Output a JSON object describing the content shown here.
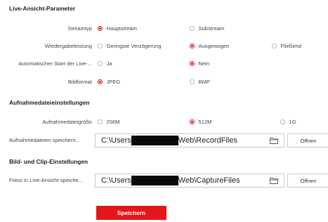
{
  "live_view": {
    "title": "Live-Ansicht-Parameter",
    "stream_type": {
      "label": "Streamtyp",
      "options": [
        {
          "label": "Hauptstream",
          "selected": true
        },
        {
          "label": "Substream",
          "selected": false
        }
      ]
    },
    "playback_delay": {
      "label": "Wiedergabeleistung",
      "options": [
        {
          "label": "Geringste Verzögerung",
          "selected": false
        },
        {
          "label": "Ausgewogen",
          "selected": true
        },
        {
          "label": "Fließend",
          "selected": false
        }
      ]
    },
    "auto_start": {
      "label": "Automatischer Start der Live-...",
      "options": [
        {
          "label": "Ja",
          "selected": false
        },
        {
          "label": "Nein",
          "selected": true
        }
      ]
    },
    "image_format": {
      "label": "Bildformat",
      "options": [
        {
          "label": "JPEG",
          "selected": true
        },
        {
          "label": "BMP",
          "selected": false
        }
      ]
    }
  },
  "record": {
    "title": "Aufnahmedateieinstellungen",
    "file_size": {
      "label": "Aufnahmedateigröße",
      "options": [
        {
          "label": "256M",
          "selected": false
        },
        {
          "label": "512M",
          "selected": true
        },
        {
          "label": "1G",
          "selected": false
        }
      ]
    },
    "save_path": {
      "label": "Aufnahmedateien speichern...",
      "prefix": "C:\\Users",
      "suffix": "Web\\RecordFiles",
      "open_label": "Öffnen"
    }
  },
  "capture": {
    "title": "Bild- und Clip-Einstellungen",
    "save_path": {
      "label": "Fotos in Live-Ansicht speiche...",
      "prefix": "C:\\Users",
      "suffix": "Web\\CaptureFiles",
      "open_label": "Öffnen"
    }
  },
  "save_button": "Speichern",
  "colors": {
    "accent": "#e3161b",
    "redaction": "#0a0a0a"
  },
  "icons": {
    "radio": "radio-icon",
    "folder": "folder-icon"
  }
}
